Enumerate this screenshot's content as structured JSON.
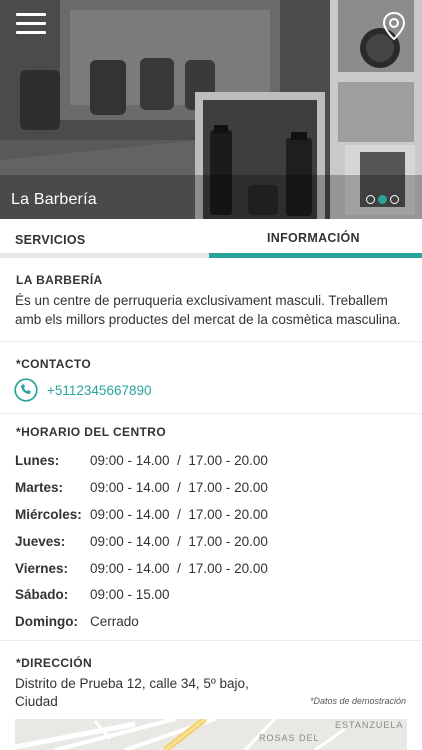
{
  "header": {
    "title": "La Barbería",
    "menu_icon": "hamburger-menu-icon",
    "location_icon": "map-pin-icon",
    "carousel": {
      "count": 3,
      "active_index": 1
    },
    "accent_color": "#2aa39b"
  },
  "tabs": [
    {
      "label": "SERVICIOS",
      "active": false
    },
    {
      "label": "INFORMACIÓN",
      "active": true
    }
  ],
  "about": {
    "title": "LA BARBERÍA",
    "lines": [
      "És un centre de perruqueria exclusivament masculi. Treballem",
      "amb els millors productes del mercat de la cosmètica masculina."
    ]
  },
  "contact": {
    "title": "*CONTACTO",
    "phone": "+5112345667890",
    "phone_icon": "phone-icon"
  },
  "schedule": {
    "title": "*HORARIO DEL CENTRO",
    "rows": [
      {
        "day": "Lunes:",
        "hours": "09:00 - 14.00  /  17.00 - 20.00"
      },
      {
        "day": "Martes:",
        "hours": "09:00 - 14.00  /  17.00 - 20.00"
      },
      {
        "day": "Miércoles:",
        "hours": "09:00 - 14.00  /  17.00 - 20.00"
      },
      {
        "day": "Jueves:",
        "hours": "09:00 - 14.00  /  17.00 - 20.00"
      },
      {
        "day": "Viernes:",
        "hours": "09:00 - 14.00  /  17.00 - 20.00"
      },
      {
        "day": "Sábado:",
        "hours": "09:00 - 15.00"
      },
      {
        "day": "Domingo:",
        "hours": "Cerrado"
      }
    ]
  },
  "address": {
    "title": "*DIRECCIÓN",
    "line1": "Distrito de Prueba 12, calle 34, 5º bajo,",
    "line2": "Ciudad",
    "demo_note": "*Datos de demostración"
  },
  "map": {
    "label_top": "ESTANZUELA",
    "label_bottom": "ROSAS DEL"
  }
}
